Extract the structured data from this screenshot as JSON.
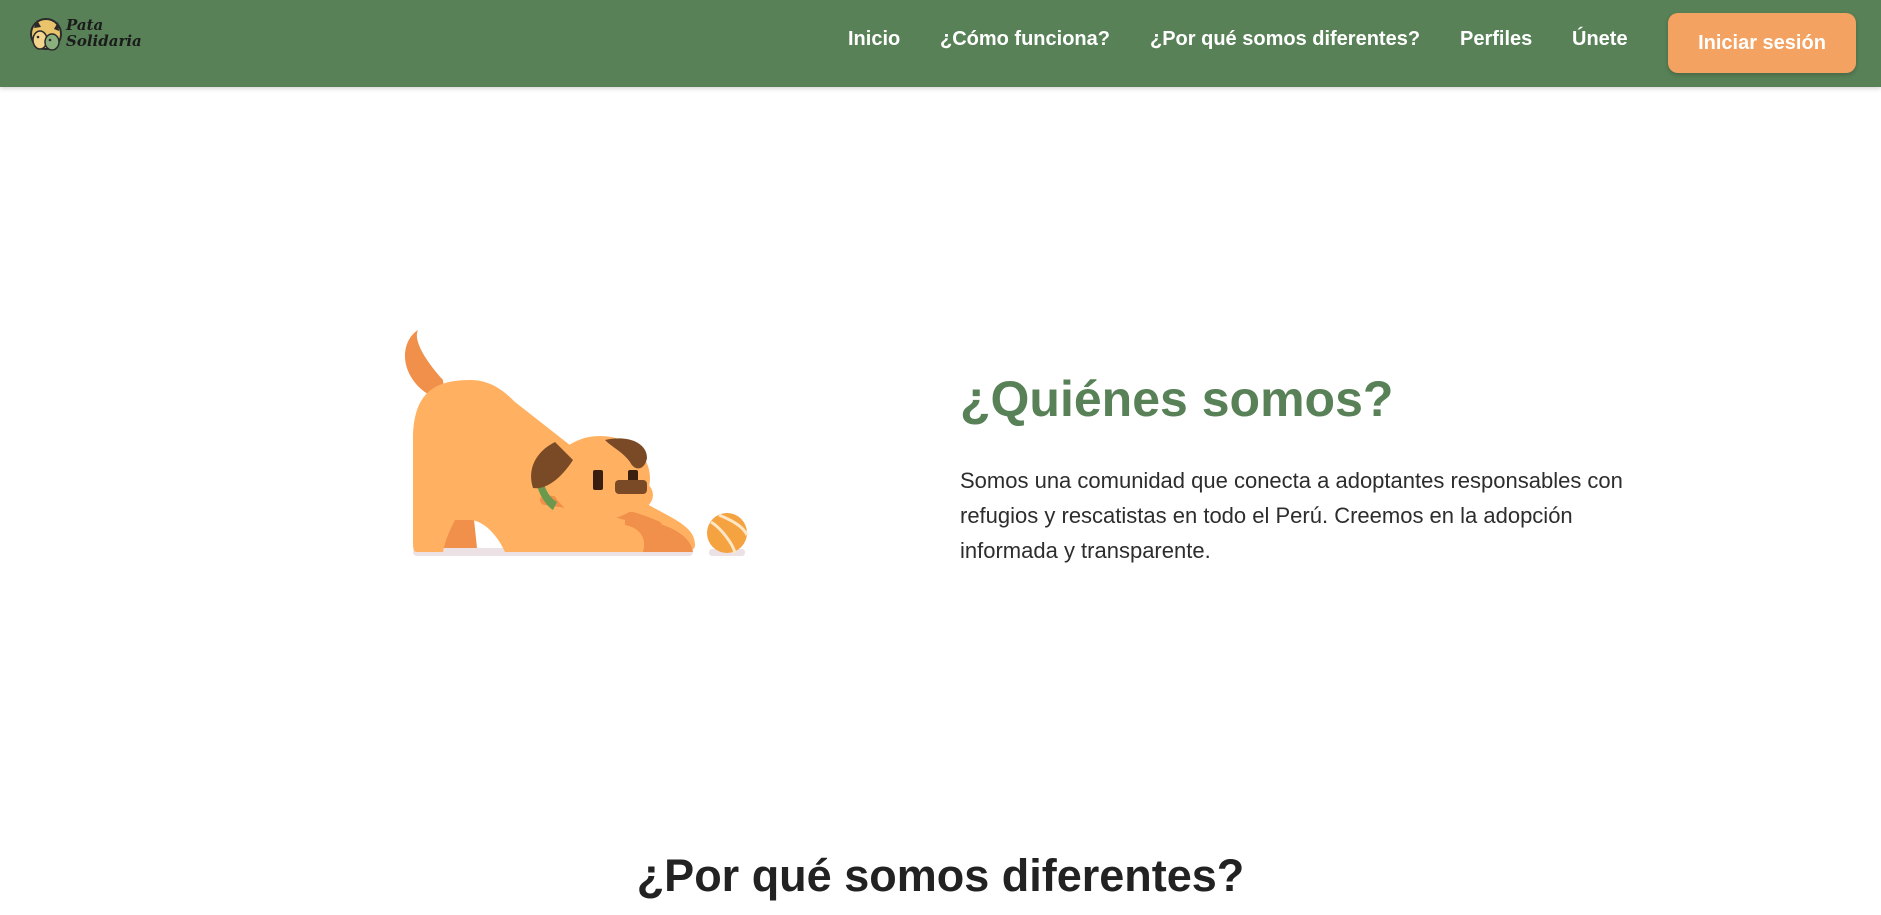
{
  "brand": {
    "name_line1": "Pata",
    "name_line2": "Solidaria"
  },
  "nav": {
    "items": [
      {
        "label": "Inicio"
      },
      {
        "label": "¿Cómo funciona?"
      },
      {
        "label": "¿Por qué somos diferentes?"
      },
      {
        "label": "Perfiles"
      },
      {
        "label": "Únete"
      }
    ],
    "login_label": "Iniciar sesión"
  },
  "about": {
    "title": "¿Quiénes somos?",
    "text": "Somos una comunidad que conecta a adoptantes responsables con refugios y rescatistas en todo el Perú. Creemos en la adopción informada y transparente."
  },
  "why": {
    "title": "¿Por qué somos diferentes?"
  },
  "colors": {
    "navbar": "#588157",
    "accent": "#f4a261",
    "heading_green": "#588157",
    "dog_body": "#ffb161",
    "dog_ear": "#7a4a26"
  },
  "icons": {
    "logo": "dog-and-cat-logo",
    "illustration": "playing-dog-with-ball"
  }
}
